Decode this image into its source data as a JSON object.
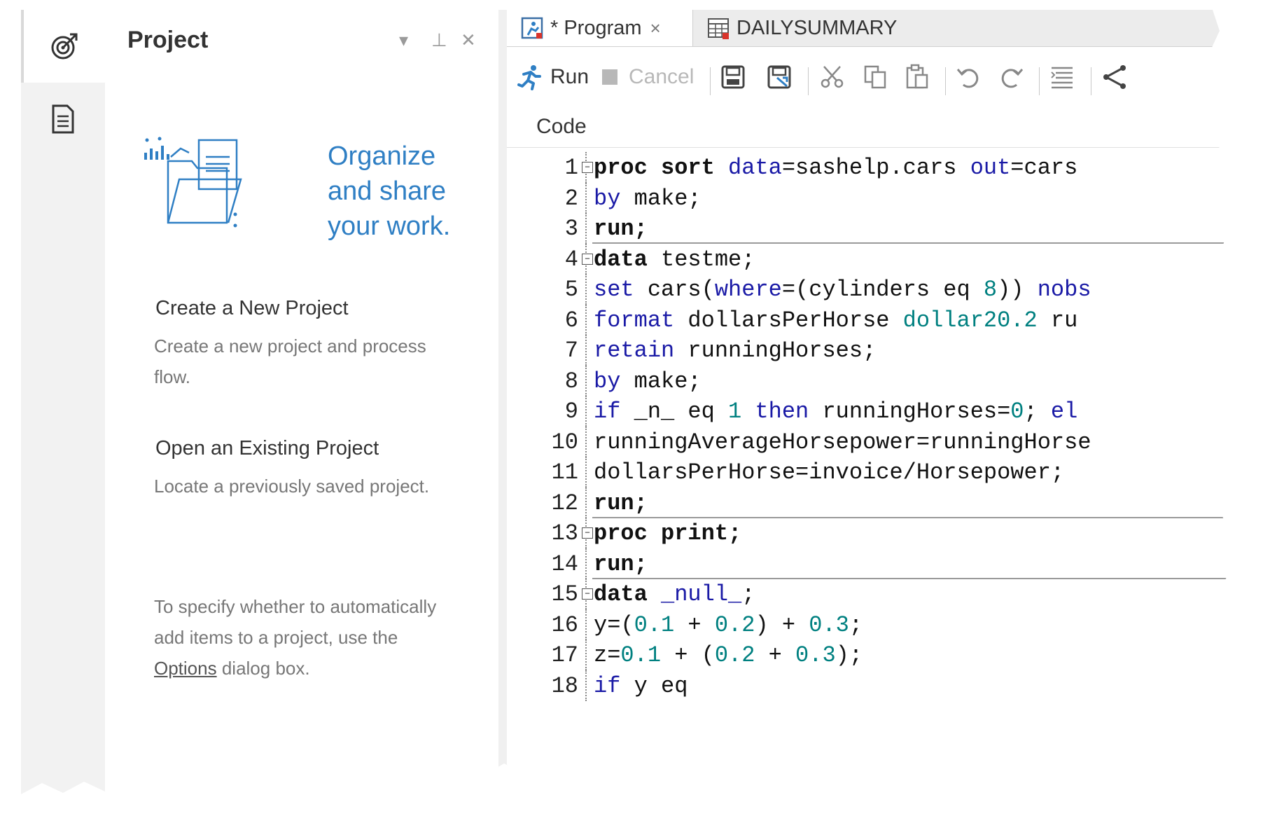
{
  "rail": {
    "items": [
      {
        "icon": "target-icon"
      },
      {
        "icon": "document-icon"
      }
    ]
  },
  "project_pane": {
    "title": "Project",
    "controls": {
      "dropdown": "▾",
      "pin": "⊥",
      "close": "✕"
    },
    "hero_text": [
      "Organize",
      "and share",
      "your work."
    ],
    "create_head": "Create a New Project",
    "create_text": "Create a new project and process flow.",
    "open_head": "Open an Existing Project",
    "open_text": "Locate a previously saved project.",
    "options_text_before": "To specify whether to automatically add items to a project, use the ",
    "options_link": "Options",
    "options_text_after": " dialog box."
  },
  "tabs": [
    {
      "label": "* Program",
      "close": "×",
      "active": true
    },
    {
      "label": "DAILYSUMMARY",
      "active": false
    }
  ],
  "toolbar": {
    "run": "Run",
    "cancel": "Cancel"
  },
  "code_subtab": "Code",
  "code_lines": [
    {
      "n": "1",
      "fold": true,
      "tokens": [
        [
          "kwb",
          "proc sort "
        ],
        [
          "kw",
          "data"
        ],
        [
          "plain",
          "=sashelp.cars "
        ],
        [
          "kw",
          "out"
        ],
        [
          "plain",
          "=cars"
        ]
      ]
    },
    {
      "n": "2",
      "tokens": [
        [
          "kw",
          "by"
        ],
        [
          "plain",
          " make;"
        ]
      ]
    },
    {
      "n": "3",
      "sep": true,
      "tokens": [
        [
          "kwb",
          "run;"
        ]
      ]
    },
    {
      "n": "4",
      "fold": true,
      "tokens": [
        [
          "kwb",
          "data"
        ],
        [
          "plain",
          " testme;"
        ]
      ]
    },
    {
      "n": "5",
      "tokens": [
        [
          "kw",
          "set"
        ],
        [
          "plain",
          " cars("
        ],
        [
          "kw",
          "where"
        ],
        [
          "plain",
          "=(cylinders eq "
        ],
        [
          "num",
          "8"
        ],
        [
          "plain",
          ")) "
        ],
        [
          "kw",
          "nobs"
        ]
      ]
    },
    {
      "n": "6",
      "tokens": [
        [
          "kw",
          "format"
        ],
        [
          "plain",
          " dollarsPerHorse "
        ],
        [
          "fmt",
          "dollar20.2"
        ],
        [
          "plain",
          " ru"
        ]
      ]
    },
    {
      "n": "7",
      "tokens": [
        [
          "kw",
          "retain"
        ],
        [
          "plain",
          " runningHorses;"
        ]
      ]
    },
    {
      "n": "8",
      "tokens": [
        [
          "kw",
          "by"
        ],
        [
          "plain",
          " make;"
        ]
      ]
    },
    {
      "n": "9",
      "tokens": [
        [
          "kw",
          "if"
        ],
        [
          "plain",
          " _n_ eq "
        ],
        [
          "num",
          "1"
        ],
        [
          "plain",
          " "
        ],
        [
          "kw",
          "then"
        ],
        [
          "plain",
          " runningHorses="
        ],
        [
          "num",
          "0"
        ],
        [
          "plain",
          "; "
        ],
        [
          "kw",
          "el"
        ]
      ]
    },
    {
      "n": "10",
      "tokens": [
        [
          "plain",
          "runningAverageHorsepower=runningHorse"
        ]
      ]
    },
    {
      "n": "11",
      "tokens": [
        [
          "plain",
          "dollarsPerHorse=invoice/Horsepower;"
        ]
      ]
    },
    {
      "n": "12",
      "sep": true,
      "tokens": [
        [
          "kwb",
          "run;"
        ]
      ]
    },
    {
      "n": "13",
      "fold": true,
      "tokens": [
        [
          "kwb",
          "proc print;"
        ]
      ]
    },
    {
      "n": "14",
      "sep": true,
      "tokens": [
        [
          "kwb",
          "run;"
        ]
      ]
    },
    {
      "n": "15",
      "fold": true,
      "tokens": [
        [
          "kwb",
          "data"
        ],
        [
          "plain",
          " "
        ],
        [
          "kw",
          "_null_"
        ],
        [
          "plain",
          ";"
        ]
      ]
    },
    {
      "n": "16",
      "tokens": [
        [
          "plain",
          "y=("
        ],
        [
          "num",
          "0.1"
        ],
        [
          "plain",
          " + "
        ],
        [
          "num",
          "0.2"
        ],
        [
          "plain",
          ") + "
        ],
        [
          "num",
          "0.3"
        ],
        [
          "plain",
          ";"
        ]
      ]
    },
    {
      "n": "17",
      "tokens": [
        [
          "plain",
          "z="
        ],
        [
          "num",
          "0.1"
        ],
        [
          "plain",
          " + ("
        ],
        [
          "num",
          "0.2"
        ],
        [
          "plain",
          " + "
        ],
        [
          "num",
          "0.3"
        ],
        [
          "plain",
          ");"
        ]
      ]
    },
    {
      "n": "18",
      "tokens": [
        [
          "kw",
          "if"
        ],
        [
          "plain",
          " y eq"
        ]
      ]
    }
  ]
}
